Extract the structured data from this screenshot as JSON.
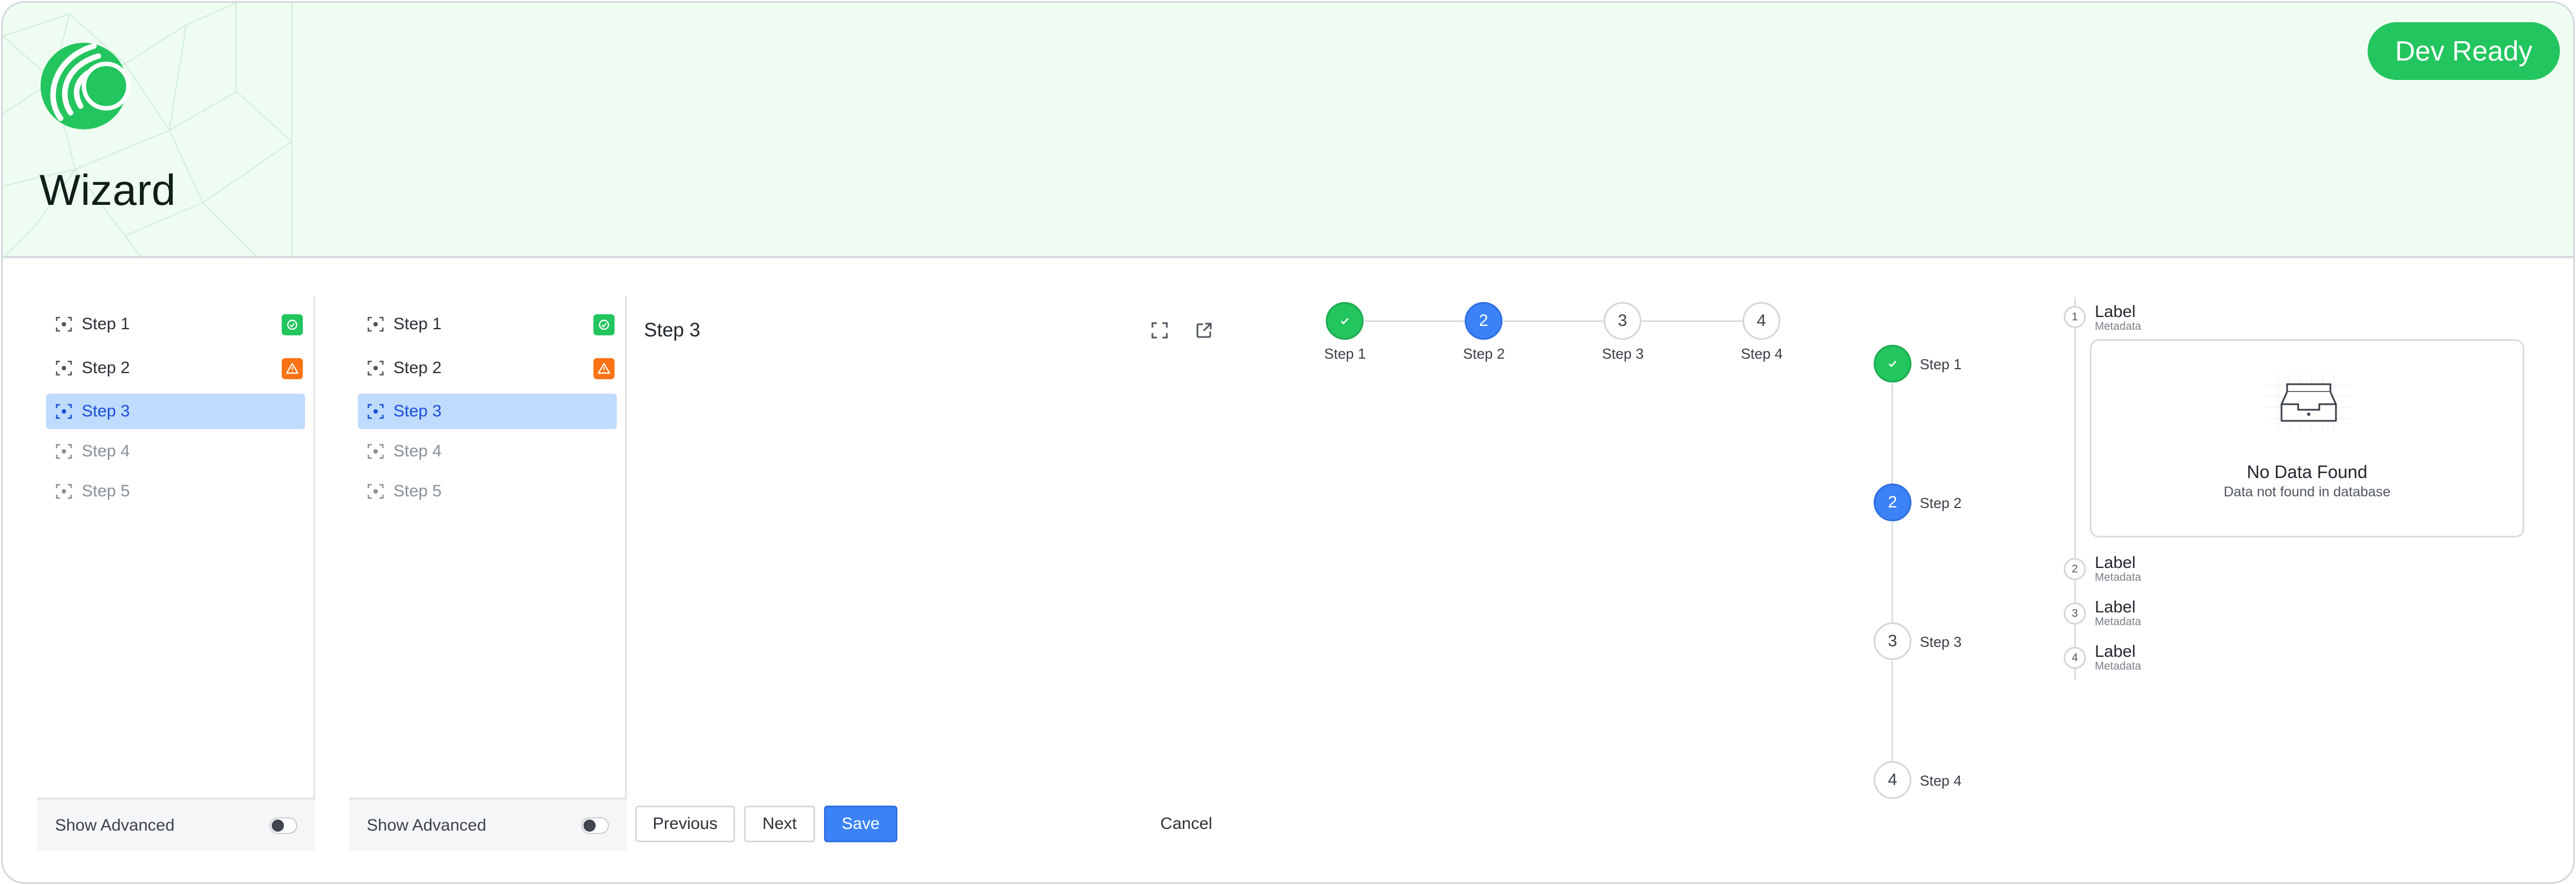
{
  "header": {
    "title": "Wizard",
    "status_label": "Dev Ready"
  },
  "nav_panels": [
    {
      "items": [
        {
          "label": "Step 1",
          "state": "complete"
        },
        {
          "label": "Step 2",
          "state": "warning"
        },
        {
          "label": "Step 3",
          "state": "active"
        },
        {
          "label": "Step 4",
          "state": "disabled"
        },
        {
          "label": "Step 5",
          "state": "disabled"
        }
      ],
      "show_advanced_label": "Show Advanced"
    },
    {
      "items": [
        {
          "label": "Step 1",
          "state": "complete"
        },
        {
          "label": "Step 2",
          "state": "warning"
        },
        {
          "label": "Step 3",
          "state": "active"
        },
        {
          "label": "Step 4",
          "state": "disabled"
        },
        {
          "label": "Step 5",
          "state": "disabled"
        }
      ],
      "show_advanced_label": "Show Advanced"
    }
  ],
  "content": {
    "title": "Step 3",
    "buttons": {
      "previous": "Previous",
      "next": "Next",
      "save": "Save",
      "cancel": "Cancel"
    }
  },
  "horizontal_stepper": {
    "steps": [
      {
        "number": "",
        "label": "Step 1",
        "state": "done"
      },
      {
        "number": "2",
        "label": "Step 2",
        "state": "current"
      },
      {
        "number": "3",
        "label": "Step 3",
        "state": "todo"
      },
      {
        "number": "4",
        "label": "Step 4",
        "state": "todo"
      }
    ]
  },
  "vertical_stepper": {
    "steps": [
      {
        "number": "",
        "label": "Step 1",
        "state": "done"
      },
      {
        "number": "2",
        "label": "Step 2",
        "state": "current"
      },
      {
        "number": "3",
        "label": "Step 3",
        "state": "todo"
      },
      {
        "number": "4",
        "label": "Step 4",
        "state": "todo"
      }
    ]
  },
  "timeline": {
    "items": [
      {
        "number": "1",
        "label": "Label",
        "metadata": "Metadata"
      },
      {
        "number": "2",
        "label": "Label",
        "metadata": "Metadata"
      },
      {
        "number": "3",
        "label": "Label",
        "metadata": "Metadata"
      },
      {
        "number": "4",
        "label": "Label",
        "metadata": "Metadata"
      }
    ],
    "empty_state": {
      "title": "No Data Found",
      "subtitle": "Data not found in database"
    }
  },
  "colors": {
    "brand_green": "#22c55e",
    "primary_blue": "#3b82f6",
    "warning_orange": "#f97316",
    "active_nav_bg": "#bfdbfe",
    "header_bg": "#effcf2"
  }
}
